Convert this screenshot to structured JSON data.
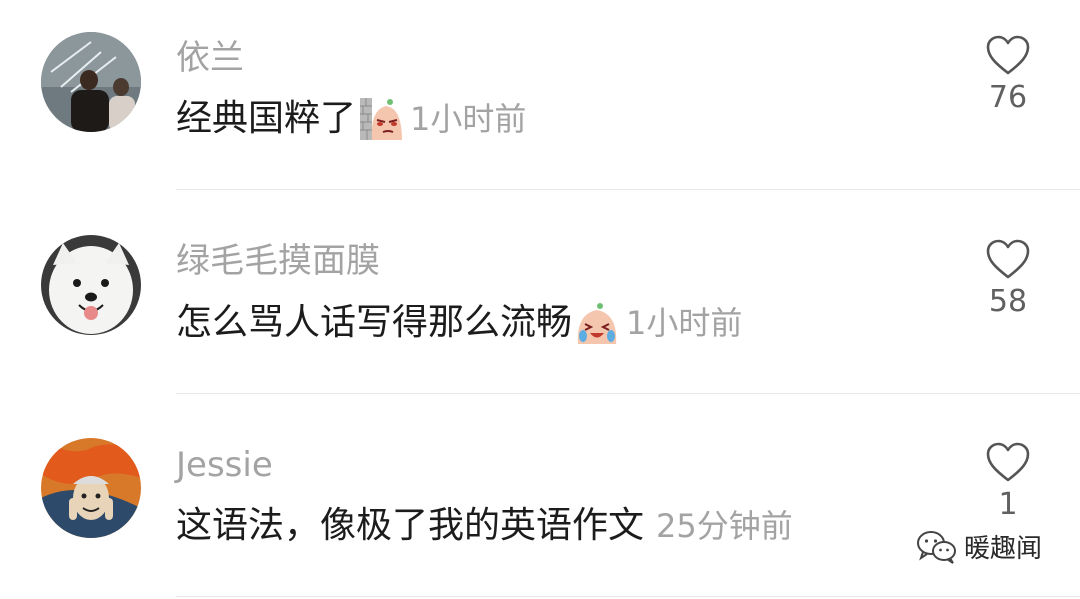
{
  "comments": [
    {
      "username": "依兰",
      "text": "经典国粹了",
      "emoji": "smug-face-behind-wall-emoji",
      "time": "1小时前",
      "likes": "76",
      "avatar": "two-people-night-photo-avatar"
    },
    {
      "username": "绿毛毛摸面膜",
      "text": "怎么骂人话写得那么流畅",
      "emoji": "laughing-crying-face-emoji",
      "time": "1小时前",
      "likes": "58",
      "avatar": "white-dog-avatar"
    },
    {
      "username": "Jessie",
      "text": "这语法，像极了我的英语作文",
      "emoji": "",
      "time": "25分钟前",
      "likes": "1",
      "avatar": "scream-painting-avatar"
    }
  ],
  "watermark": {
    "text": "暖趣闻",
    "icon": "wechat-icon"
  },
  "colors": {
    "username": "#a3a3a3",
    "content": "#1c1c1c",
    "time": "#a3a3a3",
    "likes": "#606060",
    "divider": "#e8e8e8"
  }
}
